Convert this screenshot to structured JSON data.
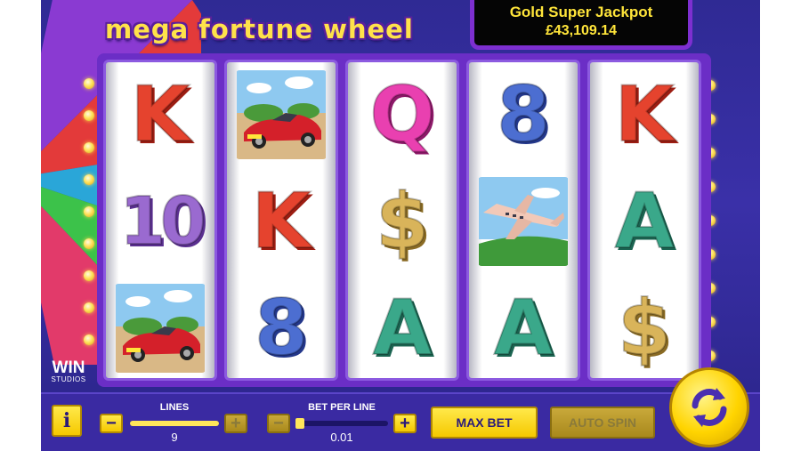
{
  "game": {
    "title": "mega fortune wheel",
    "jackpot_title": "Gold Super Jackpot",
    "jackpot_amount": "£43,109.14",
    "provider_line1": "WIN",
    "provider_line2": "STUDIOS"
  },
  "reels": [
    [
      {
        "type": "letter",
        "text": "K",
        "color": "red"
      },
      {
        "type": "number",
        "text": "10",
        "color": "purple"
      },
      {
        "type": "car"
      }
    ],
    [
      {
        "type": "car"
      },
      {
        "type": "letter",
        "text": "K",
        "color": "red"
      },
      {
        "type": "number",
        "text": "8",
        "color": "blue"
      }
    ],
    [
      {
        "type": "letter",
        "text": "Q",
        "color": "pink"
      },
      {
        "type": "letter",
        "text": "$",
        "color": "gold"
      },
      {
        "type": "letter",
        "text": "A",
        "color": "green"
      }
    ],
    [
      {
        "type": "number",
        "text": "8",
        "color": "blue"
      },
      {
        "type": "jet"
      },
      {
        "type": "letter",
        "text": "A",
        "color": "green"
      }
    ],
    [
      {
        "type": "letter",
        "text": "K",
        "color": "red"
      },
      {
        "type": "letter",
        "text": "A",
        "color": "green"
      },
      {
        "type": "letter",
        "text": "$",
        "color": "gold"
      }
    ]
  ],
  "controls": {
    "info_label": "i",
    "minus_label": "−",
    "plus_label": "+",
    "lines_label": "LINES",
    "lines_value": "9",
    "lines_fraction": 1.0,
    "bet_per_line_label": "BET PER LINE",
    "bet_per_line_value": "0.01",
    "bet_fraction": 0.0,
    "max_bet_label": "MAX BET",
    "auto_spin_label": "AUTO SPIN",
    "auto_spin_enabled": false,
    "lines_minus_enabled": true,
    "lines_plus_enabled": false,
    "bet_minus_enabled": false,
    "bet_plus_enabled": true
  },
  "icons": {
    "spin": "refresh-arrows-icon",
    "info": "info-icon"
  },
  "colors": {
    "background": "#3a30a8",
    "reel_frame": "#6b2ec6",
    "button_yellow": "#f5c800",
    "jackpot_text": "#ffe53a"
  }
}
